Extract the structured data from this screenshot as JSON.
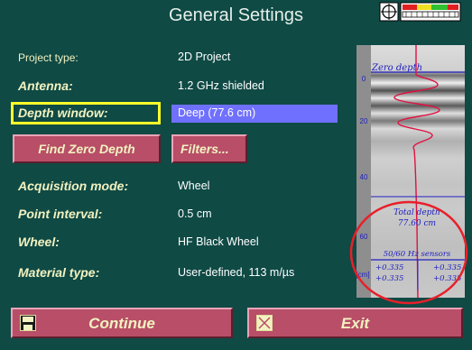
{
  "window": {
    "title": "General Settings"
  },
  "settings": {
    "project_type": {
      "label": "Project type:",
      "value": "2D Project"
    },
    "antenna": {
      "label": "Antenna:",
      "value": "1.2 GHz shielded"
    },
    "depth_window": {
      "label": "Depth window:",
      "value": "Deep (77.6 cm)"
    },
    "acquisition_mode": {
      "label": "Acquisition mode:",
      "value": "Wheel"
    },
    "point_interval": {
      "label": "Point interval:",
      "value": "0.5 cm"
    },
    "wheel": {
      "label": "Wheel:",
      "value": "HF Black Wheel"
    },
    "material_type": {
      "label": "Material type:",
      "value": "User-defined, 113 m/µs"
    }
  },
  "buttons": {
    "find_zero_depth": "Find Zero Depth",
    "filters": "Filters...",
    "continue": "Continue",
    "exit": "Exit"
  },
  "preview": {
    "zero_depth": "Zero depth",
    "total_depth_label": "Total depth",
    "total_depth_value": "77.60 cm",
    "sensors_label": "50/60 Hz sensors",
    "sensor_values": [
      "+0.335",
      "+0.335",
      "+0.335",
      "+0.335"
    ],
    "axis_ticks": [
      "0",
      "20",
      "40",
      "60"
    ],
    "axis_unit": "[cm]"
  },
  "colors": {
    "background": "#0f4a45",
    "button": "#b84e68",
    "label_text": "#f2f2c0",
    "selection_border": "#ffff2a",
    "selected_value_bg": "#7070ff",
    "highlight_circle": "#e8202a"
  },
  "icons": [
    "crosshair-icon",
    "level-meter-icon",
    "save-icon",
    "close-x-icon"
  ]
}
